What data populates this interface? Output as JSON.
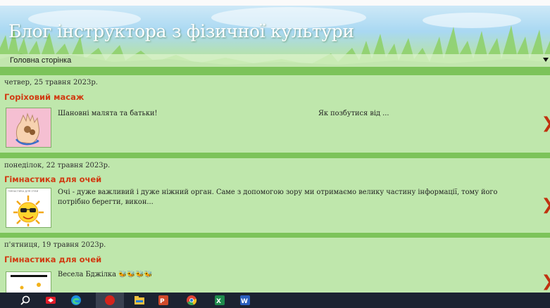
{
  "blog": {
    "title": "Блог інструктора з фізичної культури"
  },
  "nav": {
    "selected": "Головна сторінка"
  },
  "posts": [
    {
      "date": "четвер, 25 травня 2023р.",
      "title": "Горіховий масаж",
      "snippet_left": "Шановні малята та батьки!",
      "snippet_right": "Як позбутися від ..."
    },
    {
      "date": "понеділок, 22 травня 2023р.",
      "title": "Гімнастика для очей",
      "snippet": "Очі - дуже важливий  і дуже  ніжний орган. Саме з допомогою зору ми отримаємо велику частину інформації, тому його потрібно берегти, викон...",
      "thumb_text": "ГІМНАСТИКА ДЛЯ ОЧЕЙ"
    },
    {
      "date": "п'ятниця, 19 травня 2023р.",
      "title": "Гімнастика для очей",
      "snippet": "Весела Бджілка"
    }
  ],
  "icons": {
    "more": "chevron-right-icon",
    "nav_dropdown": "triangle-down-icon"
  },
  "colors": {
    "post_title": "#d13b12",
    "stripe": "#7cc35a",
    "panel": "#bfe7ac",
    "taskbar": "#1c2331"
  },
  "taskbar": {
    "apps": [
      {
        "name": "search-icon"
      },
      {
        "name": "cast-app-icon"
      },
      {
        "name": "edge-browser-icon"
      },
      {
        "name": "active-app-icon"
      },
      {
        "name": "file-explorer-icon"
      },
      {
        "name": "powerpoint-icon"
      },
      {
        "name": "chrome-browser-icon"
      },
      {
        "name": "excel-icon"
      },
      {
        "name": "word-icon"
      }
    ]
  }
}
